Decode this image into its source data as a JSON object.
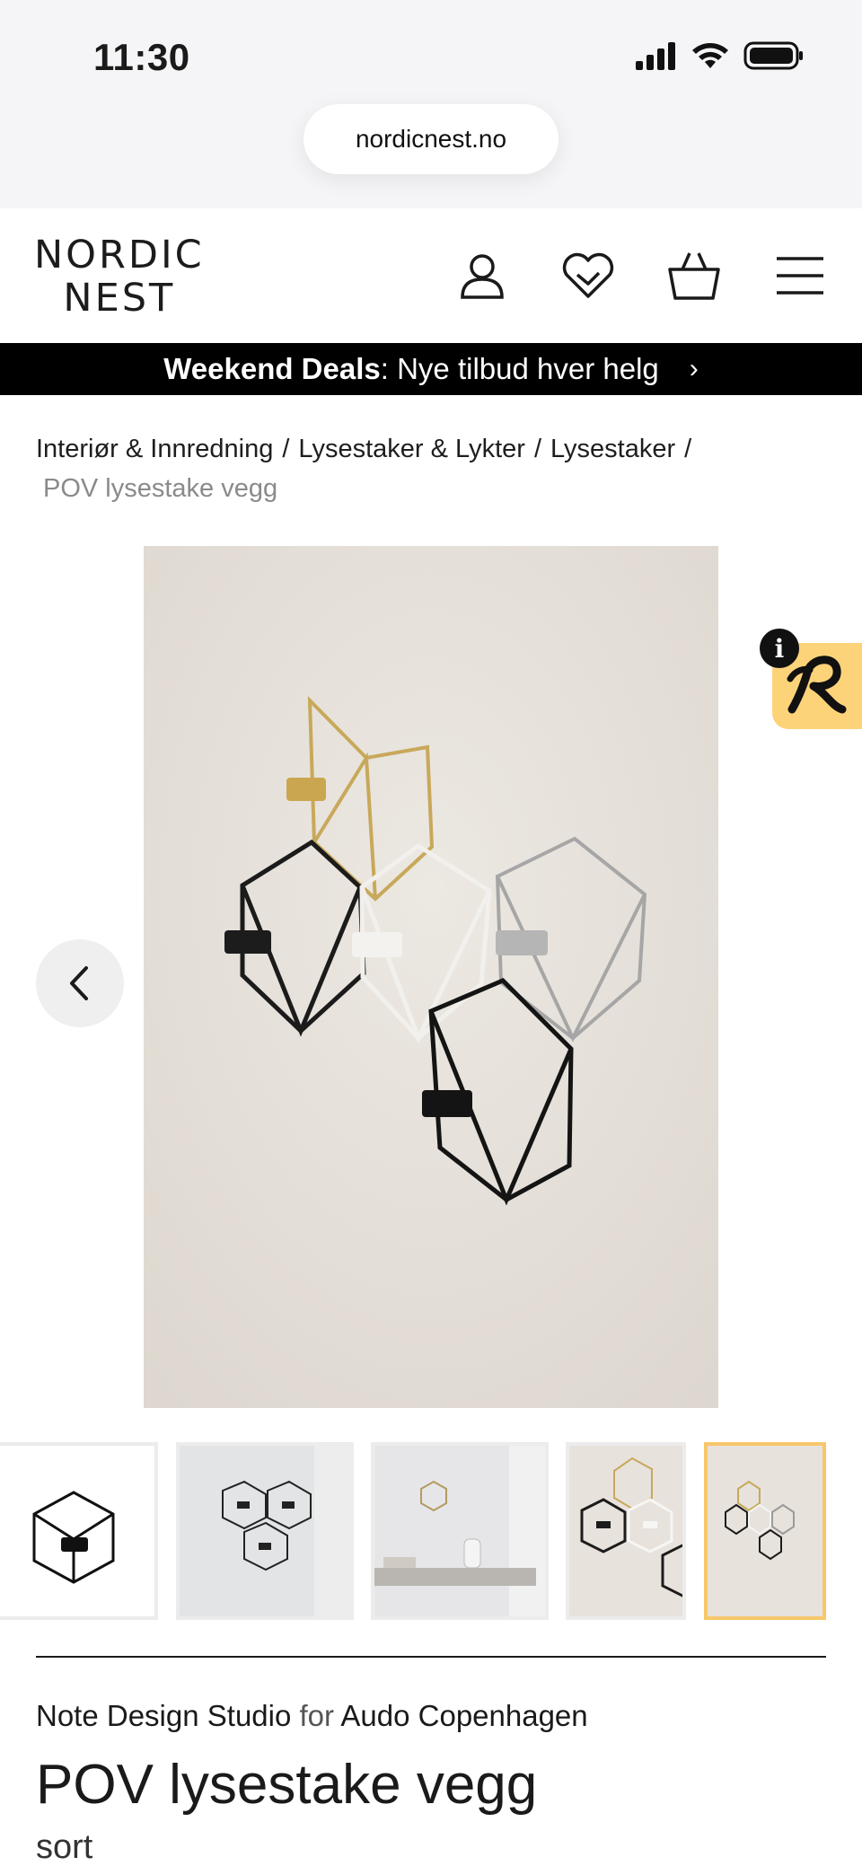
{
  "status": {
    "time": "11:30",
    "url": "nordicnest.no"
  },
  "header": {
    "logo_line1": "NORDIC",
    "logo_line2": "NEST",
    "icons": [
      "user-icon",
      "heart-icon",
      "basket-icon",
      "menu-icon"
    ]
  },
  "banner": {
    "bold": "Weekend Deals",
    "text": ": Nye tilbud hver helg",
    "chevron": "›"
  },
  "breadcrumb": {
    "items": [
      "Interiør & Innredning",
      "Lysestaker & Lykter",
      "Lysestaker"
    ],
    "separator": "/",
    "current": "POV lysestake vegg"
  },
  "gallery": {
    "info_glyph": "i",
    "thumbnail_count": 5,
    "active_thumbnail": 5
  },
  "product": {
    "designer": "Note Design Studio",
    "for": "for",
    "brand": "Audo Copenhagen",
    "title": "POV lysestake vegg",
    "variant": "sort"
  },
  "colors": {
    "accent": "#f8c76a",
    "badge": "#fdd37a",
    "banner_bg": "#000000",
    "image_bg": "#e7e2dc"
  }
}
